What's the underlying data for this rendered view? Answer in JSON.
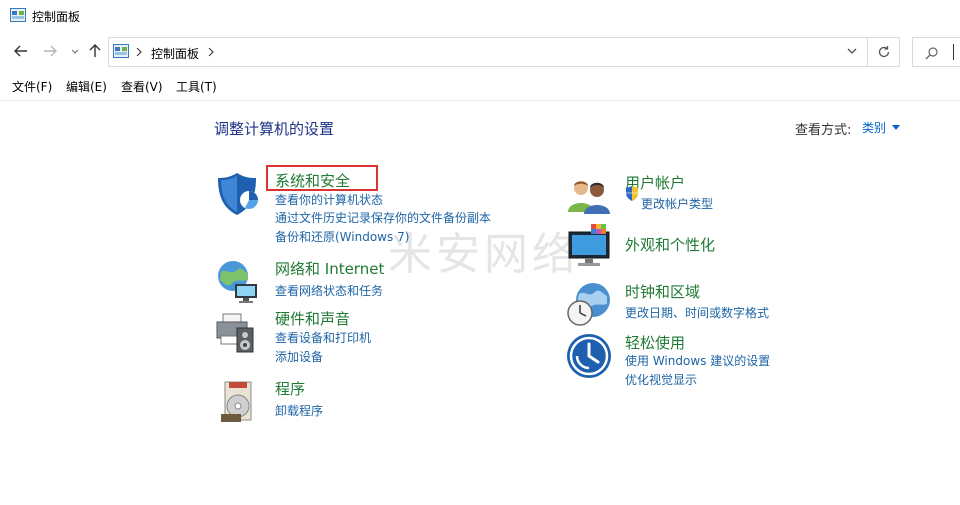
{
  "window": {
    "title": "控制面板"
  },
  "address": {
    "crumb": "控制面板"
  },
  "menu": [
    "文件(F)",
    "编辑(E)",
    "查看(V)",
    "工具(T)"
  ],
  "content": {
    "heading": "调整计算机的设置",
    "view_by_label": "查看方式:",
    "view_by_value": "类别"
  },
  "categories_left": [
    {
      "title": "系统和安全",
      "icon": "shield-icon",
      "links": [
        "查看你的计算机状态",
        "通过文件历史记录保存你的文件备份副本",
        "备份和还原(Windows 7)"
      ]
    },
    {
      "title": "网络和 Internet",
      "icon": "globe-network-icon",
      "links": [
        "查看网络状态和任务"
      ]
    },
    {
      "title": "硬件和声音",
      "icon": "printer-speaker-icon",
      "links": [
        "查看设备和打印机",
        "添加设备"
      ]
    },
    {
      "title": "程序",
      "icon": "programs-disk-icon",
      "links": [
        "卸载程序"
      ]
    }
  ],
  "categories_right": [
    {
      "title": "用户帐户",
      "icon": "users-icon",
      "links": [
        "更改帐户类型"
      ]
    },
    {
      "title": "外观和个性化",
      "icon": "monitor-palette-icon",
      "links": []
    },
    {
      "title": "时钟和区域",
      "icon": "clock-globe-icon",
      "links": [
        "更改日期、时间或数字格式"
      ]
    },
    {
      "title": "轻松使用",
      "icon": "ease-of-access-icon",
      "links": [
        "使用 Windows 建议的设置",
        "优化视觉显示"
      ]
    }
  ],
  "watermark": "米安网络",
  "colors": {
    "heading": "#1e3287",
    "category_title": "#207a33",
    "link": "#1e64a6",
    "highlight": "#d9342f"
  }
}
